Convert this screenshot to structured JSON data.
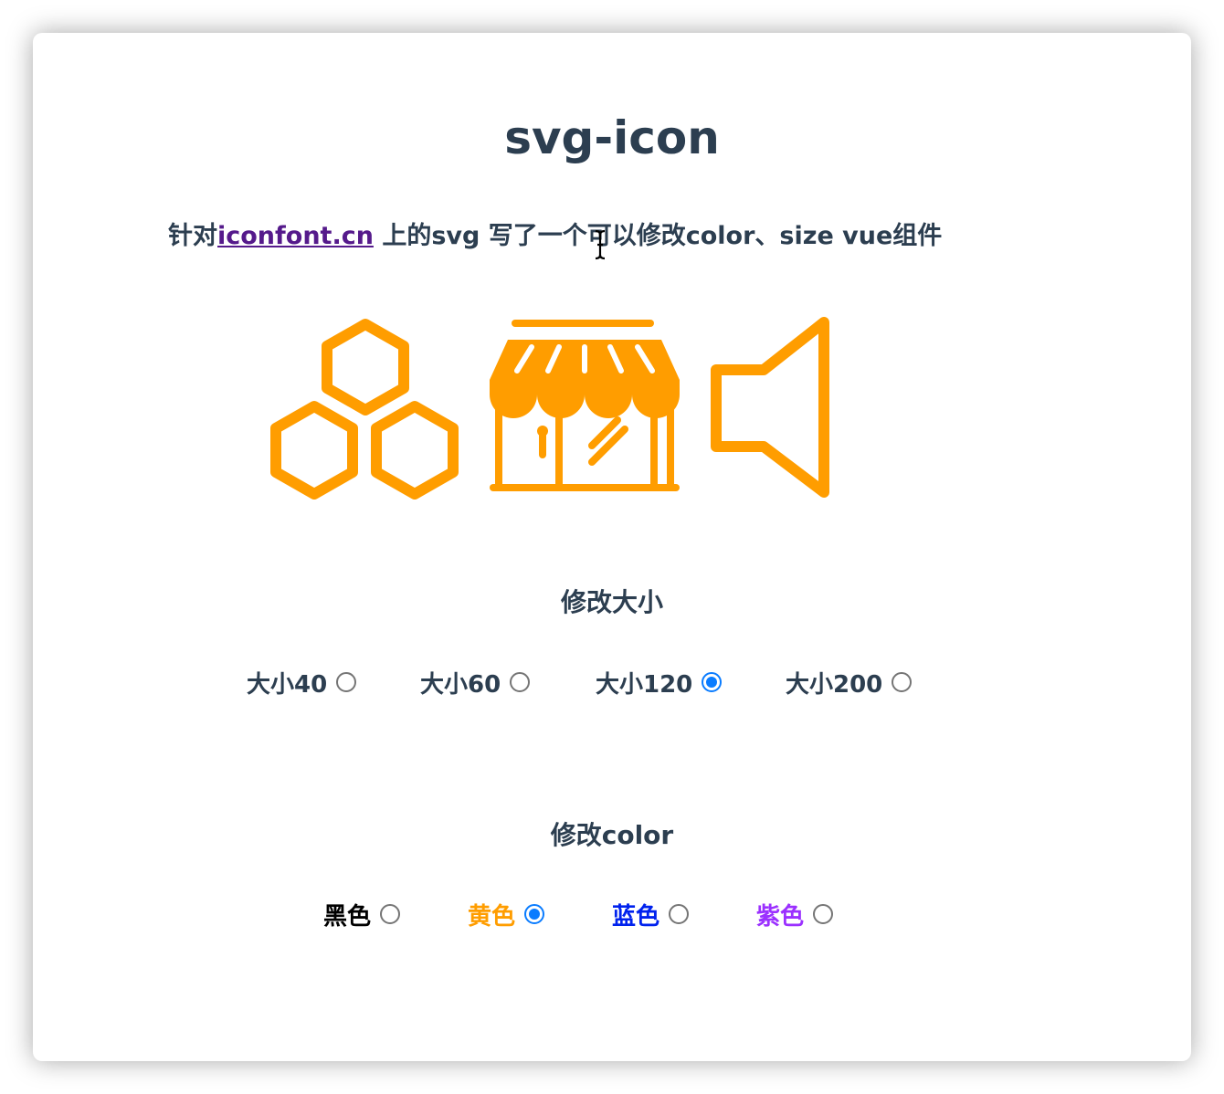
{
  "header": {
    "title": "svg-icon"
  },
  "description": {
    "prefix": "针对",
    "link_text": "iconfont.cn",
    "suffix": " 上的svg 写了一个可以修改color、size vue组件"
  },
  "icons": {
    "color": "#ff9d00",
    "items": [
      "hexagons-icon",
      "store-icon",
      "speaker-icon"
    ]
  },
  "size_section": {
    "title": "修改大小",
    "options": [
      {
        "label": "大小40",
        "checked": false
      },
      {
        "label": "大小60",
        "checked": false
      },
      {
        "label": "大小120",
        "checked": true
      },
      {
        "label": "大小200",
        "checked": false
      }
    ]
  },
  "color_section": {
    "title": "修改color",
    "options": [
      {
        "label": "黑色",
        "checked": false,
        "color": "#000000"
      },
      {
        "label": "黄色",
        "checked": true,
        "color": "#ff9d00"
      },
      {
        "label": "蓝色",
        "checked": false,
        "color": "#0022ee"
      },
      {
        "label": "紫色",
        "checked": false,
        "color": "#9b30ff"
      }
    ]
  },
  "colors": {
    "text": "#2c3e50",
    "link": "#551a8b",
    "radio_checked": "#0a7cff"
  }
}
